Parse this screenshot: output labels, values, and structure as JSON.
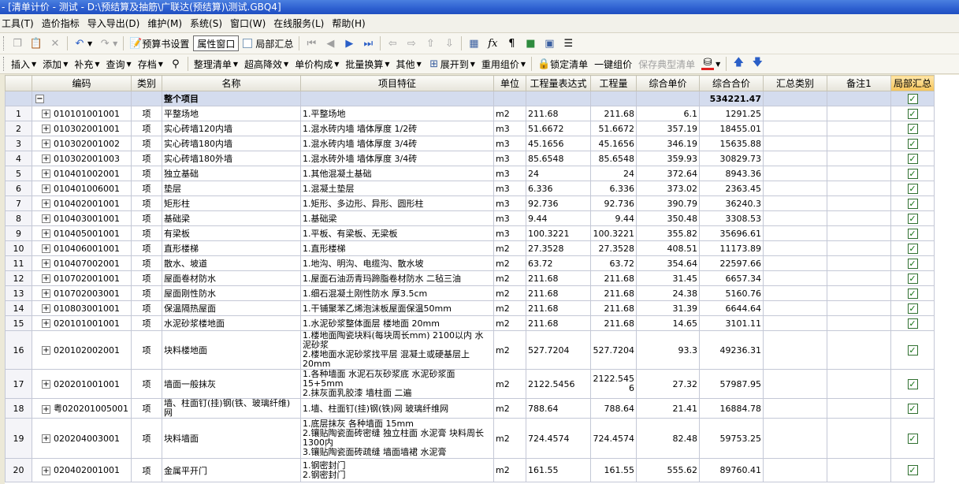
{
  "window": {
    "title": "- [清单计价 - 测试 - D:\\预结算及抽筋\\广联达(预结算)\\测试.GBQ4]"
  },
  "menu": [
    "工具(T)",
    "造价指标",
    "导入导出(D)",
    "维护(M)",
    "系统(S)",
    "窗口(W)",
    "在线服务(L)",
    "帮助(H)"
  ],
  "toolbar1": {
    "budget_settings": "预算书设置",
    "attr_window": "属性窗口",
    "local_summary": "局部汇总"
  },
  "toolbar2": {
    "insert": "插入",
    "add": "添加",
    "supplement": "补充",
    "query": "查询",
    "save": "存档",
    "organize": "整理清单",
    "overheight": "超高降效",
    "unit_price": "单价构成",
    "batch": "批量换算",
    "other": "其他",
    "expand": "展开到",
    "reuse": "重用组价",
    "lock": "锁定清单",
    "one_click": "一键组价",
    "save_typical": "保存典型清单"
  },
  "table": {
    "headers": [
      "",
      "编码",
      "类别",
      "名称",
      "项目特征",
      "单位",
      "工程量表达式",
      "工程量",
      "综合单价",
      "综合合价",
      "汇总类别",
      "备注1",
      "局部汇总"
    ],
    "summary": {
      "name": "整个项目",
      "total": "534221.47"
    },
    "rows": [
      {
        "n": "1",
        "code": "010101001001",
        "cat": "项",
        "name": "平整场地",
        "feat": "1.平整场地",
        "unit": "m2",
        "expr": "211.68",
        "qty": "211.68",
        "price": "6.1",
        "total": "1291.25"
      },
      {
        "n": "2",
        "code": "010302001001",
        "cat": "项",
        "name": "实心砖墙120内墙",
        "feat": "1.混水砖内墙 墙体厚度 1/2砖",
        "unit": "m3",
        "expr": "51.6672",
        "qty": "51.6672",
        "price": "357.19",
        "total": "18455.01"
      },
      {
        "n": "3",
        "code": "010302001002",
        "cat": "项",
        "name": "实心砖墙180内墙",
        "feat": "1.混水砖内墙 墙体厚度 3/4砖",
        "unit": "m3",
        "expr": "45.1656",
        "qty": "45.1656",
        "price": "346.19",
        "total": "15635.88"
      },
      {
        "n": "4",
        "code": "010302001003",
        "cat": "项",
        "name": "实心砖墙180外墙",
        "feat": "1.混水砖外墙 墙体厚度 3/4砖",
        "unit": "m3",
        "expr": "85.6548",
        "qty": "85.6548",
        "price": "359.93",
        "total": "30829.73"
      },
      {
        "n": "5",
        "code": "010401002001",
        "cat": "项",
        "name": "独立基础",
        "feat": "1.其他混凝土基础",
        "unit": "m3",
        "expr": "24",
        "qty": "24",
        "price": "372.64",
        "total": "8943.36"
      },
      {
        "n": "6",
        "code": "010401006001",
        "cat": "项",
        "name": "垫层",
        "feat": "1.混凝土垫层",
        "unit": "m3",
        "expr": "6.336",
        "qty": "6.336",
        "price": "373.02",
        "total": "2363.45"
      },
      {
        "n": "7",
        "code": "010402001001",
        "cat": "项",
        "name": "矩形柱",
        "feat": "1.矩形、多边形、异形、圆形柱",
        "unit": "m3",
        "expr": "92.736",
        "qty": "92.736",
        "price": "390.79",
        "total": "36240.3"
      },
      {
        "n": "8",
        "code": "010403001001",
        "cat": "项",
        "name": "基础梁",
        "feat": "1.基础梁",
        "unit": "m3",
        "expr": "9.44",
        "qty": "9.44",
        "price": "350.48",
        "total": "3308.53"
      },
      {
        "n": "9",
        "code": "010405001001",
        "cat": "项",
        "name": "有梁板",
        "feat": "1.平板、有梁板、无梁板",
        "unit": "m3",
        "expr": "100.3221",
        "qty": "100.3221",
        "price": "355.82",
        "total": "35696.61"
      },
      {
        "n": "10",
        "code": "010406001001",
        "cat": "项",
        "name": "直形楼梯",
        "feat": "1.直形楼梯",
        "unit": "m2",
        "expr": "27.3528",
        "qty": "27.3528",
        "price": "408.51",
        "total": "11173.89"
      },
      {
        "n": "11",
        "code": "010407002001",
        "cat": "项",
        "name": "散水、坡道",
        "feat": "1.地沟、明沟、电缆沟、散水坡",
        "unit": "m2",
        "expr": "63.72",
        "qty": "63.72",
        "price": "354.64",
        "total": "22597.66"
      },
      {
        "n": "12",
        "code": "010702001001",
        "cat": "项",
        "name": "屋面卷材防水",
        "feat": "1.屋面石油沥青玛蹄脂卷材防水 二毡三油",
        "unit": "m2",
        "expr": "211.68",
        "qty": "211.68",
        "price": "31.45",
        "total": "6657.34"
      },
      {
        "n": "13",
        "code": "010702003001",
        "cat": "项",
        "name": "屋面刚性防水",
        "feat": "1.细石混凝土刚性防水 厚3.5cm",
        "unit": "m2",
        "expr": "211.68",
        "qty": "211.68",
        "price": "24.38",
        "total": "5160.76"
      },
      {
        "n": "14",
        "code": "010803001001",
        "cat": "项",
        "name": "保温隔热屋面",
        "feat": "1.干铺聚苯乙烯泡沫板屋面保温50mm",
        "unit": "m2",
        "expr": "211.68",
        "qty": "211.68",
        "price": "31.39",
        "total": "6644.64"
      },
      {
        "n": "15",
        "code": "020101001001",
        "cat": "项",
        "name": "水泥砂浆楼地面",
        "feat": "1.水泥砂浆整体面层 楼地面 20mm",
        "unit": "m2",
        "expr": "211.68",
        "qty": "211.68",
        "price": "14.65",
        "total": "3101.11"
      },
      {
        "n": "16",
        "code": "020102002001",
        "cat": "项",
        "name": "块料楼地面",
        "feat": "1.楼地面陶瓷块料(每块周长mm) 2100以内 水泥砂浆\n2.楼地面水泥砂浆找平层 混凝土或硬基层上 20mm",
        "unit": "m2",
        "expr": "527.7204",
        "qty": "527.7204",
        "price": "93.3",
        "total": "49236.31"
      },
      {
        "n": "17",
        "code": "020201001001",
        "cat": "项",
        "name": "墙面一般抹灰",
        "feat": "1.各种墙面 水泥石灰砂浆底 水泥砂浆面 15+5mm\n2.抹灰面乳胶漆 墙柱面 二遍",
        "unit": "m2",
        "expr": "2122.5456",
        "qty": "2122.545\n6",
        "price": "27.32",
        "total": "57987.95"
      },
      {
        "n": "18",
        "code": "粤020201005001",
        "cat": "项",
        "name": "墙、柱面钉(挂)钢(铁、玻璃纤维)网",
        "feat": "1.墙、柱面钉(挂)钢(铁)网 玻璃纤维网",
        "unit": "m2",
        "expr": "788.64",
        "qty": "788.64",
        "price": "21.41",
        "total": "16884.78"
      },
      {
        "n": "19",
        "code": "020204003001",
        "cat": "项",
        "name": "块料墙面",
        "feat": "1.底层抹灰 各种墙面 15mm\n2.镶贴陶瓷面砖密缝 独立柱面 水泥膏 块料周长1300内\n3.镶贴陶瓷面砖疏缝 墙面墙裙 水泥膏",
        "unit": "m2",
        "expr": "724.4574",
        "qty": "724.4574",
        "price": "82.48",
        "total": "59753.25"
      },
      {
        "n": "20",
        "code": "020402001001",
        "cat": "项",
        "name": "金属平开门",
        "feat": "1.钢密封门\n2.钢密封门",
        "unit": "m2",
        "expr": "161.55",
        "qty": "161.55",
        "price": "555.62",
        "total": "89760.41"
      }
    ]
  }
}
